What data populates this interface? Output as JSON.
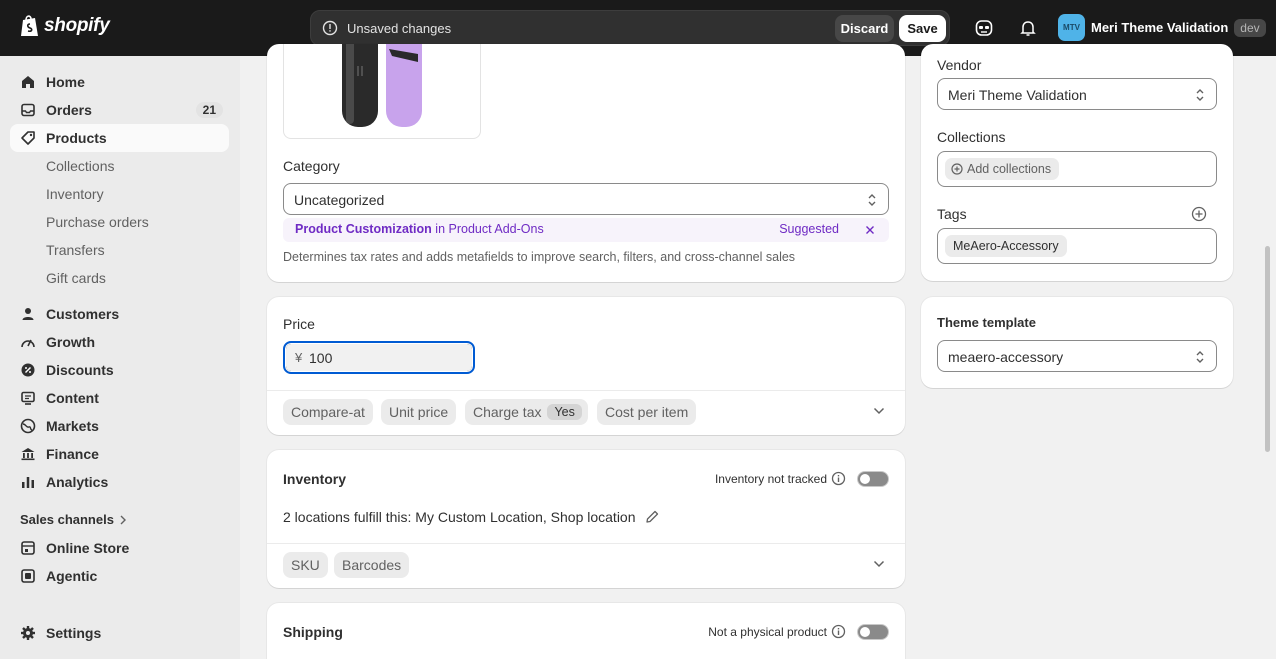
{
  "topbar": {
    "brand": "shopify",
    "unsaved_message": "Unsaved changes",
    "discard_label": "Discard",
    "save_label": "Save",
    "avatar_initials": "MTV",
    "store_name": "Meri Theme Validation",
    "dev_badge": "dev"
  },
  "sidebar": {
    "home": "Home",
    "orders": "Orders",
    "orders_count": "21",
    "products": "Products",
    "collections": "Collections",
    "inventory": "Inventory",
    "purchase_orders": "Purchase orders",
    "transfers": "Transfers",
    "gift_cards": "Gift cards",
    "customers": "Customers",
    "growth": "Growth",
    "discounts": "Discounts",
    "content": "Content",
    "markets": "Markets",
    "finance": "Finance",
    "analytics": "Analytics",
    "sales_channels": "Sales channels",
    "online_store": "Online Store",
    "agentic": "Agentic",
    "settings": "Settings"
  },
  "category": {
    "label": "Category",
    "value": "Uncategorized",
    "suggestion_name": "Product Customization",
    "suggestion_in": "in",
    "suggestion_parent": "Product Add-Ons",
    "suggested_label": "Suggested",
    "help": "Determines tax rates and adds metafields to improve search, filters, and cross-channel sales"
  },
  "price": {
    "label": "Price",
    "currency": "¥",
    "value": "100",
    "compare_at": "Compare-at",
    "unit_price": "Unit price",
    "charge_tax": "Charge tax",
    "charge_tax_value": "Yes",
    "cost_per_item": "Cost per item"
  },
  "inventory": {
    "title": "Inventory",
    "tracking_label": "Inventory not tracked",
    "locations": "2 locations fulfill this: My Custom Location, Shop location",
    "sku": "SKU",
    "barcodes": "Barcodes"
  },
  "shipping": {
    "title": "Shipping",
    "physical_label": "Not a physical product"
  },
  "organization": {
    "vendor_label": "Vendor",
    "vendor_value": "Meri Theme Validation",
    "collections_label": "Collections",
    "add_collections": "Add collections",
    "tags_label": "Tags",
    "tag_value": "MeAero-Accessory"
  },
  "theme_template": {
    "title": "Theme template",
    "value": "meaero-accessory"
  },
  "colors": {
    "topbar": "#1a1a1a",
    "accent_purple": "#6f2bc4",
    "focus_blue": "#005bd3"
  }
}
